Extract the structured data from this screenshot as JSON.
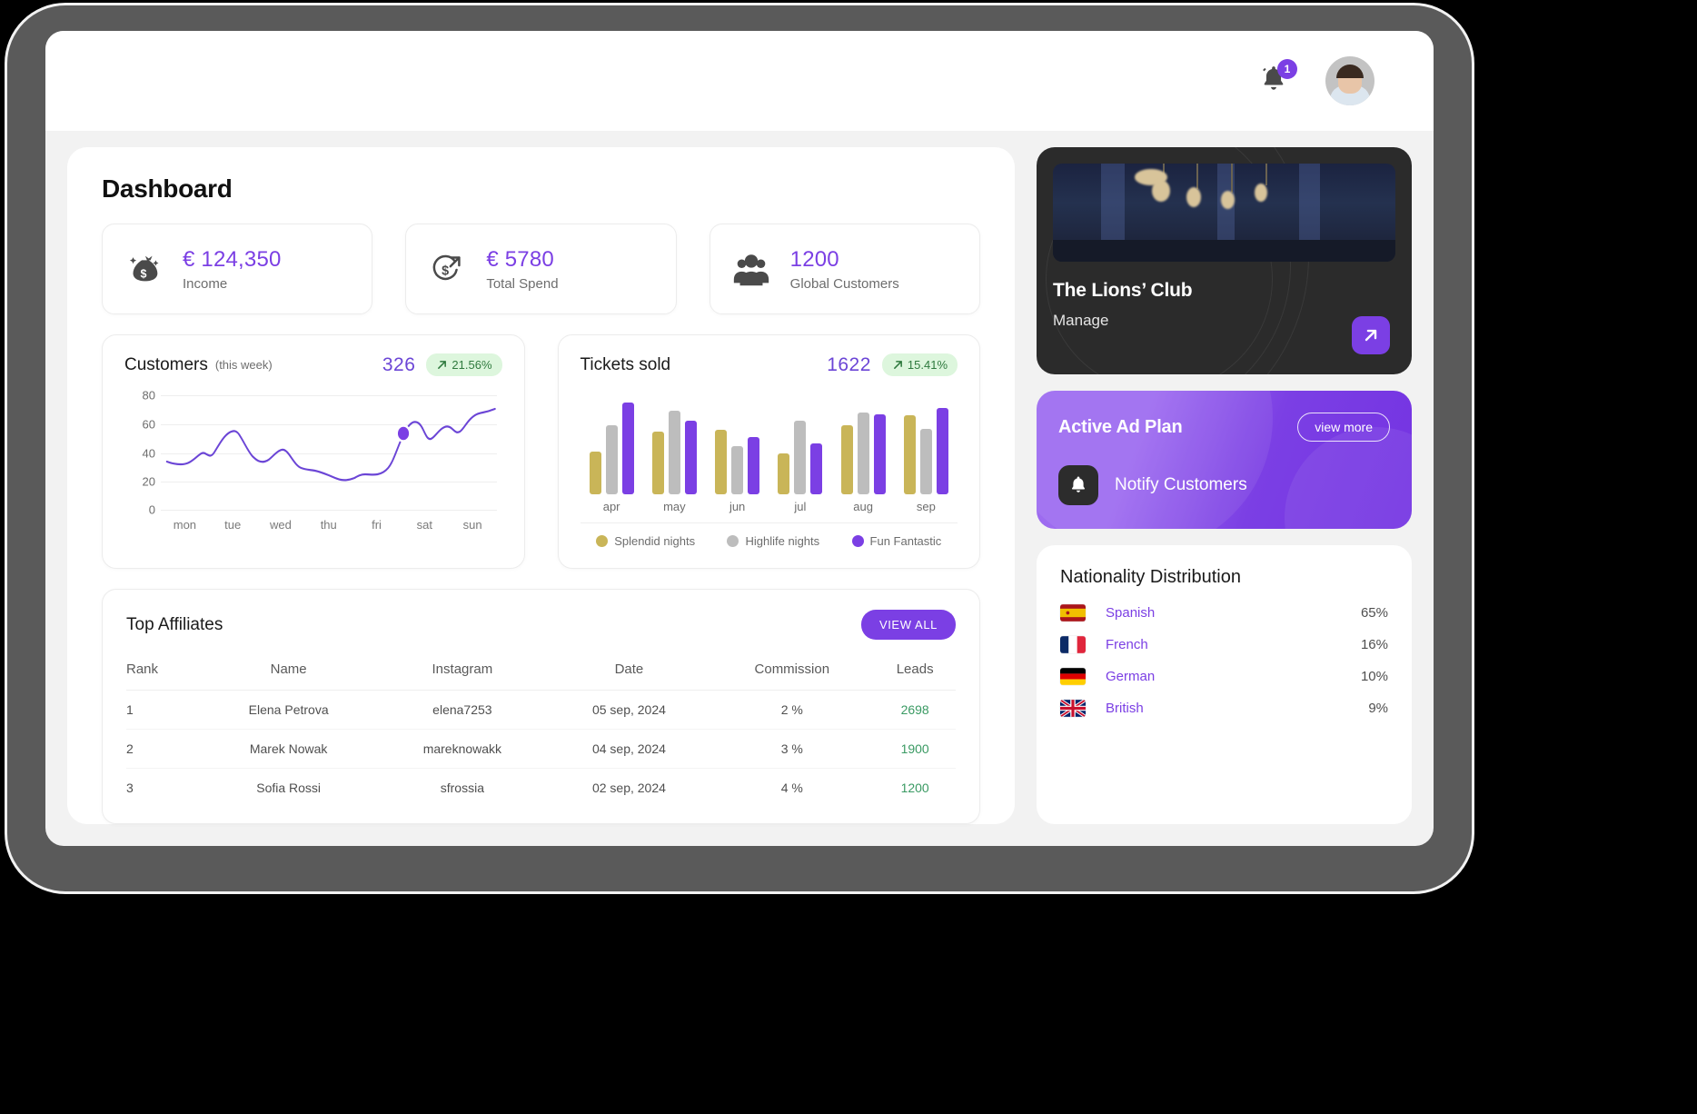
{
  "header": {
    "notification_count": "1",
    "bell_icon": "bell-icon",
    "avatar_alt": "user-avatar"
  },
  "main": {
    "page_title": "Dashboard",
    "stats": [
      {
        "icon": "money-bag-icon",
        "value": "€ 124,350",
        "label": "Income"
      },
      {
        "icon": "spend-arrow-icon",
        "value": "€ 5780",
        "label": "Total Spend"
      },
      {
        "icon": "customers-group-icon",
        "value": "1200",
        "label": "Global Customers"
      }
    ],
    "customers_card": {
      "title": "Customers",
      "subtitle": "(this week)",
      "total": "326",
      "trend": "21.56%",
      "trend_icon": "trend-up-arrow-icon"
    },
    "tickets_card": {
      "title": "Tickets sold",
      "total": "1622",
      "trend": "15.41%",
      "trend_icon": "trend-up-arrow-icon"
    },
    "affiliates": {
      "title": "Top Affiliates",
      "view_all_label": "VIEW ALL",
      "columns": [
        "Rank",
        "Name",
        "Instagram",
        "Date",
        "Commission",
        "Leads"
      ],
      "rows": [
        {
          "rank": "1",
          "name": "Elena Petrova",
          "instagram": "elena7253",
          "date": "05 sep, 2024",
          "commission": "2 %",
          "leads": "2698"
        },
        {
          "rank": "2",
          "name": "Marek Nowak",
          "instagram": "mareknowakk",
          "date": "04 sep, 2024",
          "commission": "3 %",
          "leads": "1900"
        },
        {
          "rank": "3",
          "name": "Sofia Rossi",
          "instagram": "sfrossia",
          "date": "02 sep, 2024",
          "commission": "4 %",
          "leads": "1200"
        }
      ]
    }
  },
  "sidebar": {
    "venue": {
      "name": "The Lions’ Club",
      "action_label": "Manage",
      "arrow_icon": "arrow-up-right-icon"
    },
    "ad_plan": {
      "title": "Active Ad Plan",
      "view_more_label": "view more",
      "item_icon": "bell-icon",
      "item_label": "Notify Customers"
    },
    "nationality": {
      "title": "Nationality Distribution",
      "rows": [
        {
          "flag": "flag-spain",
          "name": "Spanish",
          "pct": "65%"
        },
        {
          "flag": "flag-france",
          "name": "French",
          "pct": "16%"
        },
        {
          "flag": "flag-germany",
          "name": "German",
          "pct": "10%"
        },
        {
          "flag": "flag-uk",
          "name": "British",
          "pct": "9%"
        }
      ]
    }
  },
  "colors": {
    "accent_purple": "#7b3fe4",
    "line_purple": "#6b45d6",
    "bar_gold": "#c9b558",
    "bar_gray": "#bdbdbd",
    "bar_purple": "#7b3fe4",
    "trend_green_text": "#2f7a3e",
    "trend_green_bg": "#ddf6dd",
    "leads_green": "#3a9a63",
    "card_dark": "#2b2b2b",
    "screen_bg": "#f2f2f2",
    "bezel": "#5a5a5a"
  },
  "chart_data": [
    {
      "type": "line",
      "title": "Customers",
      "subtitle": "(this week)",
      "total": 326,
      "trend_pct": 21.56,
      "xlabel": "",
      "ylabel": "",
      "ylim": [
        0,
        90
      ],
      "yticks": [
        0,
        20,
        40,
        60,
        80
      ],
      "grid": true,
      "categories": [
        "mon",
        "tue",
        "wed",
        "thu",
        "fri",
        "sat",
        "sun"
      ],
      "x": [
        0,
        1,
        2,
        3,
        4,
        5,
        6,
        7,
        8,
        9,
        10,
        11,
        12,
        13,
        14,
        15,
        16,
        17,
        18,
        19,
        20,
        21,
        22,
        23,
        24,
        25,
        26,
        27
      ],
      "values": [
        35,
        33,
        33,
        34,
        36,
        39,
        37,
        42,
        49,
        54,
        52,
        46,
        40,
        36,
        35,
        37,
        39,
        35,
        32,
        30,
        29,
        28,
        25,
        24,
        27,
        28,
        28,
        29
      ],
      "values_tail": [
        34,
        48,
        63,
        62,
        56,
        57,
        64,
        65,
        63,
        70,
        75,
        76,
        77,
        79,
        78,
        80
      ],
      "highlight_point": {
        "x_label": "fri+",
        "y": 63,
        "color": "#7b3fe4"
      },
      "line_color": "#6b45d6"
    },
    {
      "type": "bar",
      "title": "Tickets sold",
      "total": 1622,
      "trend_pct": 15.41,
      "categories": [
        "apr",
        "may",
        "jun",
        "jul",
        "aug",
        "sep"
      ],
      "ylim": [
        0,
        100
      ],
      "grid": false,
      "legend_position": "bottom",
      "series": [
        {
          "name": "Splendid nights",
          "color": "#c9b558",
          "values": [
            42,
            62,
            63,
            40,
            68,
            78
          ]
        },
        {
          "name": "Highlife nights",
          "color": "#bdbdbd",
          "values": [
            68,
            82,
            47,
            72,
            80,
            64
          ]
        },
        {
          "name": "Fun Fantastic",
          "color": "#7b3fe4",
          "values": [
            90,
            72,
            56,
            50,
            79,
            85
          ]
        }
      ]
    },
    {
      "type": "bar",
      "title": "Nationality Distribution",
      "categories": [
        "Spanish",
        "French",
        "German",
        "British"
      ],
      "values": [
        65,
        16,
        10,
        9
      ],
      "ylabel": "%",
      "xlabel": ""
    }
  ]
}
